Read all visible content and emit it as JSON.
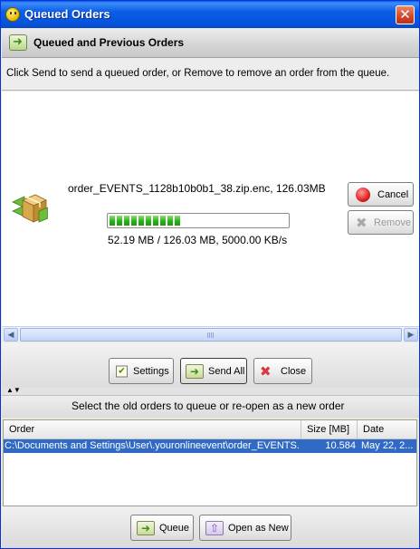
{
  "window": {
    "title": "Queued Orders",
    "close_glyph": "✕"
  },
  "header": {
    "title": "Queued and Previous Orders",
    "instructions": "Click Send to send a queued order, or Remove to remove an order from the queue."
  },
  "current_order": {
    "name": "order_EVENTS_1128b10b0b1_38.zip.enc, 126.03MB",
    "progress_fraction": 0.415,
    "progress_text": "52.19 MB / 126.03 MB,  5000.00 KB/s",
    "cancel_label": "Cancel",
    "remove_label": "Remove",
    "remove_enabled": false
  },
  "scrollbar": {
    "left_glyph": "◀",
    "right_glyph": "▶"
  },
  "actions": {
    "settings_label": "Settings",
    "send_all_label": "Send All",
    "close_label": "Close"
  },
  "splitter": {
    "arrows": "▲▼"
  },
  "old_orders": {
    "caption": "Select the old orders to queue or re-open as a new order",
    "columns": [
      "Order",
      "Size [MB]",
      "Date"
    ],
    "rows": [
      {
        "order": "C:\\Documents and Settings\\User\\.youronlineevent\\order_EVENTS...",
        "size": "10.584",
        "date": "May 22, 2...",
        "selected": true
      }
    ]
  },
  "bottom": {
    "queue_label": "Queue",
    "open_as_new_label": "Open as New"
  },
  "colors": {
    "title_bar": "#0553da",
    "selection": "#316ac5",
    "progress": "#25b516",
    "cancel": "#e02020"
  }
}
